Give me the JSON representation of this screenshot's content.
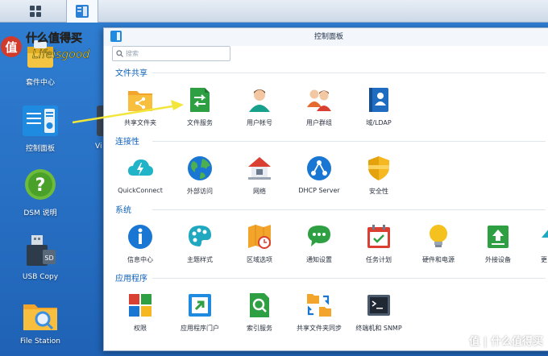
{
  "desktop": {
    "icons": [
      {
        "label": "套件中心"
      },
      {
        "label": "控制面板"
      },
      {
        "label": "DSM 说明"
      },
      {
        "label": "USB Copy"
      },
      {
        "label": "File Station"
      },
      {
        "label": "Vi"
      }
    ]
  },
  "watermark": {
    "top_line1": "值 什么值得买",
    "top_line2": "Lifeisgood",
    "bottom": "值 | 什么值得买"
  },
  "window": {
    "title": "控制面板",
    "search_placeholder": "搜索",
    "sections": [
      {
        "title": "文件共享",
        "items": [
          {
            "label": "共享文件夹",
            "icon": "shared-folder-icon"
          },
          {
            "label": "文件服务",
            "icon": "file-services-icon"
          },
          {
            "label": "用户帐号",
            "icon": "user-icon"
          },
          {
            "label": "用户群组",
            "icon": "group-icon"
          },
          {
            "label": "域/LDAP",
            "icon": "domain-ldap-icon"
          }
        ]
      },
      {
        "title": "连接性",
        "items": [
          {
            "label": "QuickConnect",
            "icon": "quickconnect-icon"
          },
          {
            "label": "外部访问",
            "icon": "external-access-icon"
          },
          {
            "label": "网络",
            "icon": "network-icon"
          },
          {
            "label": "DHCP Server",
            "icon": "dhcp-server-icon"
          },
          {
            "label": "安全性",
            "icon": "security-icon"
          }
        ]
      },
      {
        "title": "系统",
        "items": [
          {
            "label": "信息中心",
            "icon": "info-center-icon"
          },
          {
            "label": "主题样式",
            "icon": "theme-icon"
          },
          {
            "label": "区域选项",
            "icon": "regional-options-icon"
          },
          {
            "label": "通知设置",
            "icon": "notification-icon"
          },
          {
            "label": "任务计划",
            "icon": "task-scheduler-icon"
          },
          {
            "label": "硬件和电源",
            "icon": "hardware-power-icon"
          },
          {
            "label": "外接设备",
            "icon": "external-devices-icon"
          },
          {
            "label": "更",
            "icon": "update-icon"
          }
        ]
      },
      {
        "title": "应用程序",
        "items": [
          {
            "label": "权限",
            "icon": "privileges-icon"
          },
          {
            "label": "应用程序门户",
            "icon": "application-portal-icon"
          },
          {
            "label": "索引服务",
            "icon": "indexing-service-icon"
          },
          {
            "label": "共享文件夹同步",
            "icon": "shared-folder-sync-icon"
          },
          {
            "label": "终端机和 SNMP",
            "icon": "terminal-snmp-icon"
          }
        ]
      }
    ]
  },
  "colors": {
    "desktop_bg": "#2a74c8",
    "section_title": "#0f62b9",
    "arrow": "#f2e63a"
  }
}
